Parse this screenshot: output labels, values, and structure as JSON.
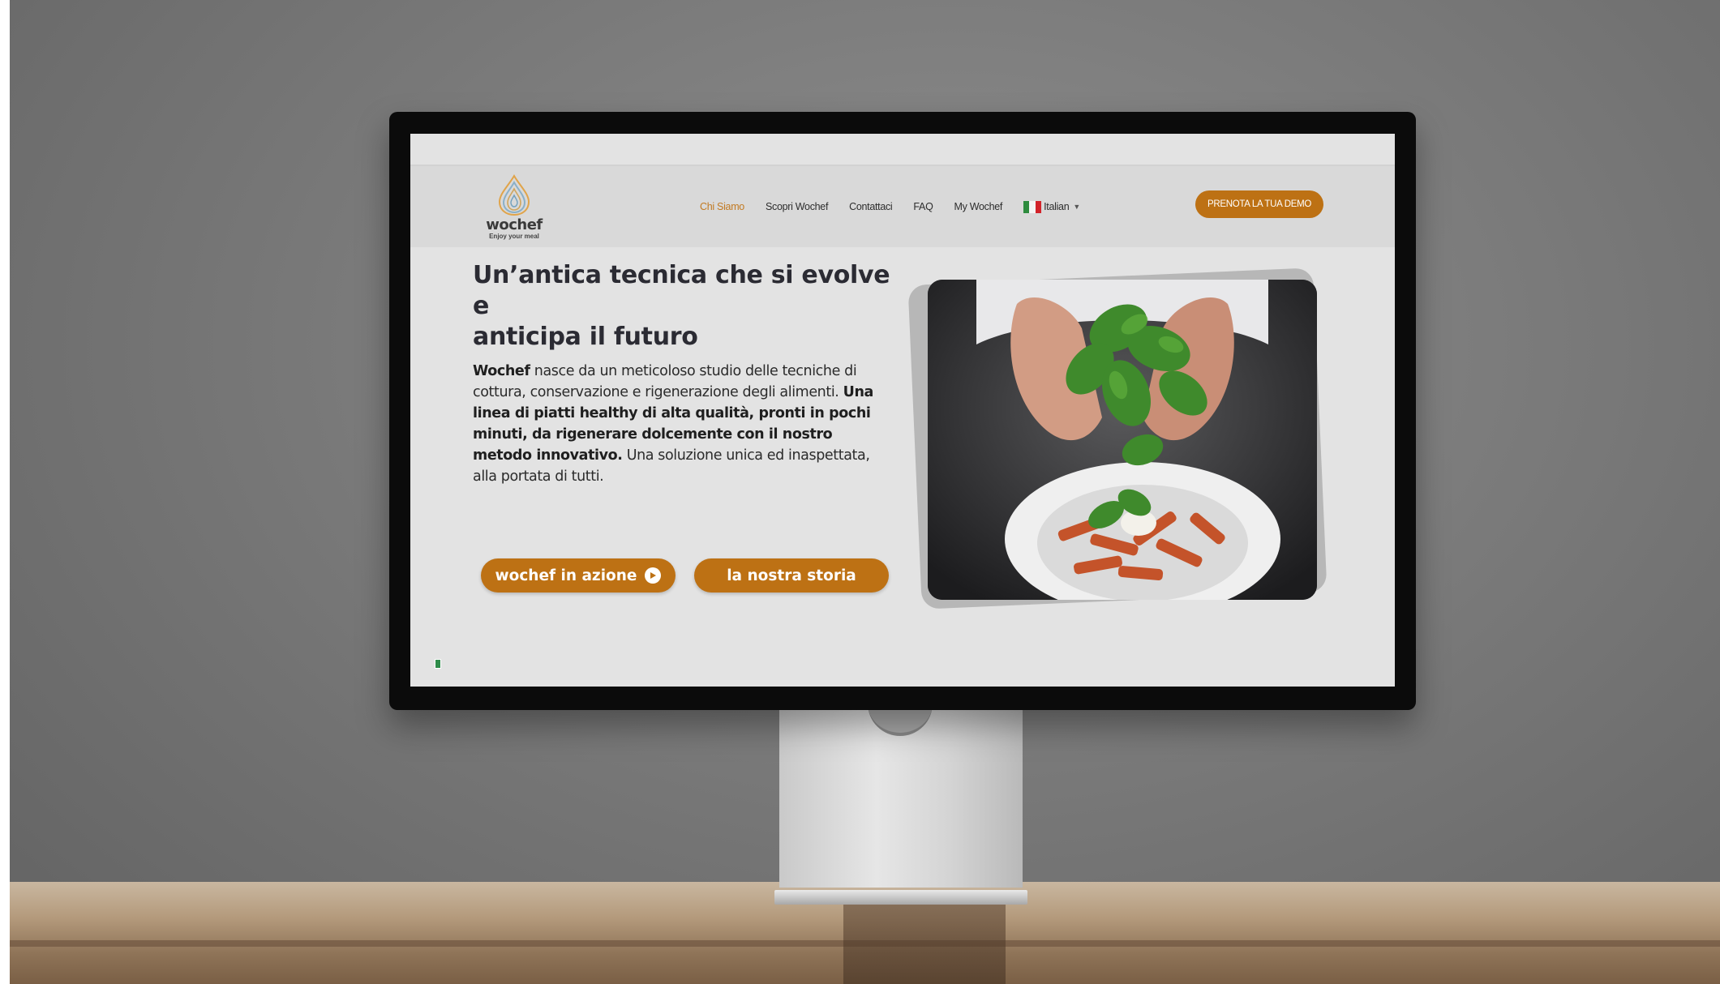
{
  "header": {
    "logo_word": "wochef",
    "logo_tagline": "Enjoy your meal",
    "nav": [
      {
        "label": "Chi Siamo",
        "active": true
      },
      {
        "label": "Scopri Wochef",
        "active": false
      },
      {
        "label": "Contattaci",
        "active": false
      },
      {
        "label": "FAQ",
        "active": false
      },
      {
        "label": "My Wochef",
        "active": false
      }
    ],
    "language": "Italian",
    "demo_button": "PRENOTA LA TUA DEMO"
  },
  "hero": {
    "title_line1": "Un’antica tecnica che si evolve e",
    "title_line2": "anticipa il futuro",
    "body": {
      "brand": "Wochef",
      "part1": " nasce da un meticoloso studio delle tecniche di cottura, conservazione e rigenerazione degli alimenti. ",
      "bold": "Una linea di piatti healthy di alta qualità, pronti in pochi minuti, da rigenerare dolcemente con il nostro metodo innovativo.",
      "part2": " Una soluzione unica ed inaspettata, alla portata di tutti."
    },
    "cta_primary": "wochef in azione",
    "cta_secondary": "la nostra storia"
  },
  "colors": {
    "accent": "#bd7114",
    "active_nav": "#c27a22",
    "text": "#2b2b33"
  },
  "icons": [
    "wochef-drop-logo-icon",
    "italian-flag-icon",
    "chevron-down-icon",
    "play-icon"
  ]
}
